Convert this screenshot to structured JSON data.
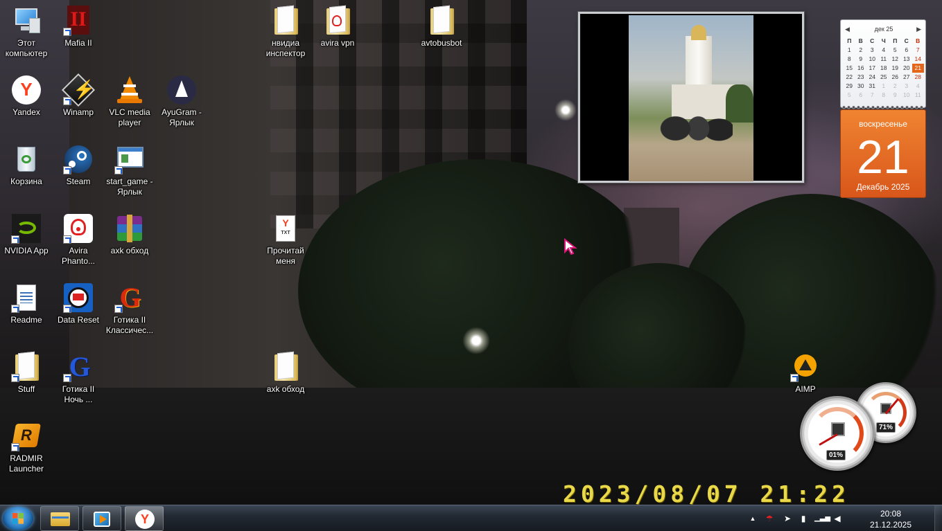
{
  "desktop": {
    "icons": [
      {
        "label": "Этот компьютер"
      },
      {
        "label": "Mafia II"
      },
      {
        "label": "нвидиа инспектор"
      },
      {
        "label": "avira vpn"
      },
      {
        "label": "avtobusbot"
      },
      {
        "label": "Yandex"
      },
      {
        "label": "Winamp"
      },
      {
        "label": "VLC media player"
      },
      {
        "label": "AyuGram - Ярлык"
      },
      {
        "label": "Корзина"
      },
      {
        "label": "Steam"
      },
      {
        "label": "start_game - Ярлык"
      },
      {
        "label": "NVIDIA App"
      },
      {
        "label": "Avira Phanto..."
      },
      {
        "label": "axk обход"
      },
      {
        "label": "Прочитай меня"
      },
      {
        "label": "Readme"
      },
      {
        "label": "Data Reset"
      },
      {
        "label": "Готика II Классичес..."
      },
      {
        "label": "Stuff"
      },
      {
        "label": "Готика II Ночь ..."
      },
      {
        "label": "axk обход"
      },
      {
        "label": "AIMP"
      },
      {
        "label": "RADMIR Launcher"
      }
    ],
    "wallpaper_timestamp": "2023/08/07  21:22",
    "txt_badge": "TXT"
  },
  "calendar": {
    "month_short": "дек 25",
    "nav_prev": "◀",
    "nav_next": "▶",
    "weekdays": [
      "П",
      "В",
      "С",
      "Ч",
      "П",
      "С",
      "В"
    ],
    "weeks": [
      [
        "1",
        "2",
        "3",
        "4",
        "5",
        "6",
        "7"
      ],
      [
        "8",
        "9",
        "10",
        "11",
        "12",
        "13",
        "14"
      ],
      [
        "15",
        "16",
        "17",
        "18",
        "19",
        "20",
        "21"
      ],
      [
        "22",
        "23",
        "24",
        "25",
        "26",
        "27",
        "28"
      ],
      [
        "29",
        "30",
        "31",
        "1",
        "2",
        "3",
        "4"
      ],
      [
        "5",
        "6",
        "7",
        "8",
        "9",
        "10",
        "11"
      ]
    ],
    "today": "21",
    "weekday_full": "воскресенье",
    "day": "21",
    "month_year": "Декабрь 2025",
    "accent": "#e4661a"
  },
  "cpu_meter": {
    "cpu_percent": "01%",
    "ram_percent": "71%"
  },
  "taskbar": {
    "pinned": [
      "explorer-icon",
      "media-player-icon",
      "yandex-browser-icon"
    ],
    "tray_expand": "▲",
    "clock_time": "20:08",
    "clock_date": "21.12.2025"
  }
}
